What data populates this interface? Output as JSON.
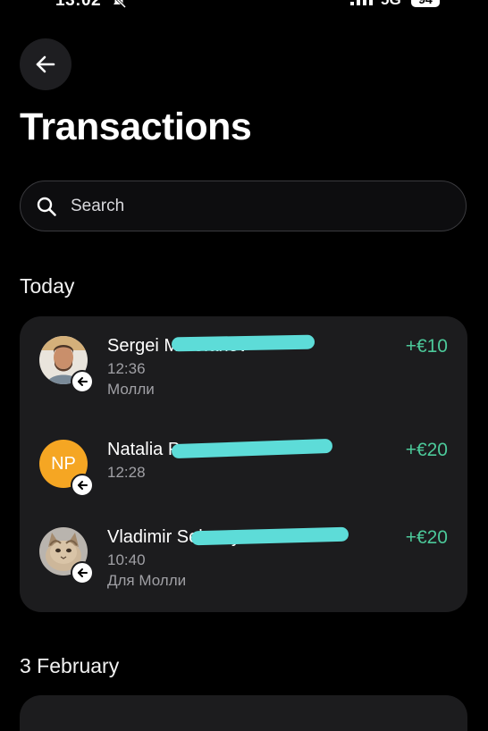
{
  "status_bar": {
    "time": "13:02",
    "network": "5G",
    "battery": "94",
    "mute_icon": "bell-slash-icon",
    "signal_icon": "signal-bars-icon"
  },
  "header": {
    "back_icon": "arrow-left-icon",
    "title": "Transactions"
  },
  "search": {
    "placeholder": "Search",
    "value": "",
    "icon": "search-icon"
  },
  "sections": [
    {
      "label": "Today",
      "transactions": [
        {
          "name": "Sergei Mitrofanov",
          "time": "12:36",
          "note": "Молли",
          "amount": "+€10",
          "avatar": "photo",
          "direction_icon": "arrow-left-icon"
        },
        {
          "name": "Natalia P",
          "initials": "NP",
          "time": "12:28",
          "note": "",
          "amount": "+€20",
          "avatar": "initials",
          "direction_icon": "arrow-left-icon"
        },
        {
          "name": "Vladimir Seleznyov",
          "time": "10:40",
          "note": "Для Молли",
          "amount": "+€20",
          "avatar": "photo",
          "direction_icon": "arrow-left-icon"
        }
      ]
    },
    {
      "label": "3 February",
      "transactions": []
    }
  ],
  "colors": {
    "background": "#000000",
    "card": "#1c1c1e",
    "positive_amount": "#4cc99a",
    "secondary_text": "#a0a0a5",
    "redaction": "#5ddcd8",
    "initials_avatar": "#f5a623"
  }
}
